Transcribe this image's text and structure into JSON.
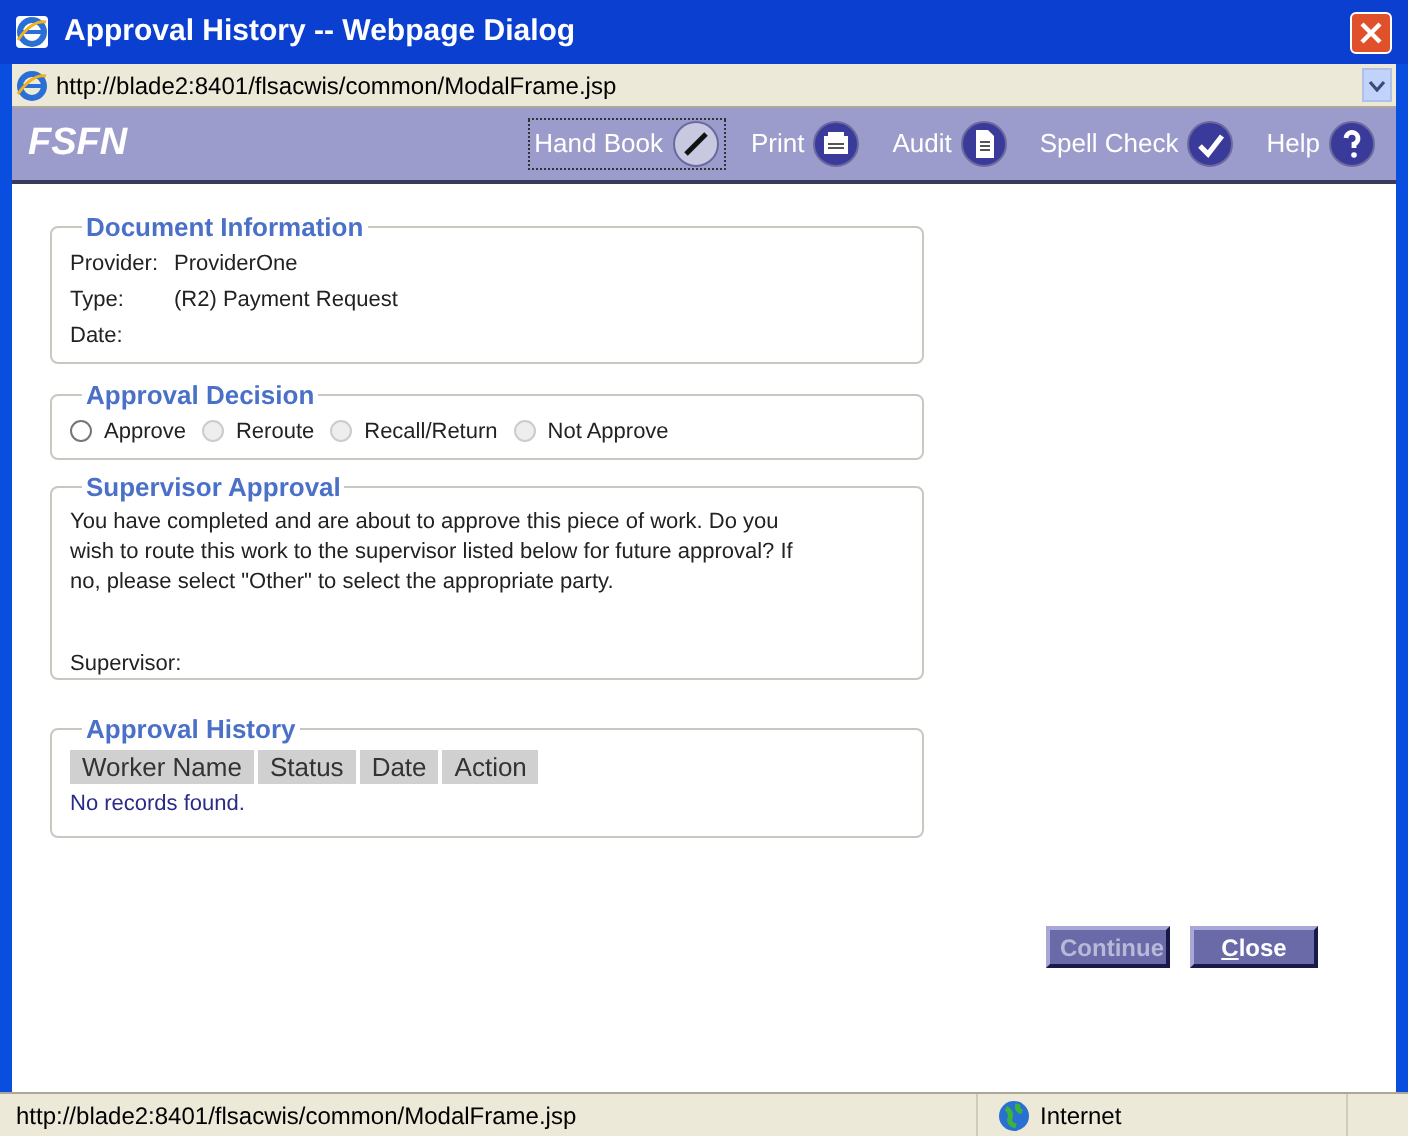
{
  "window": {
    "title": "Approval History -- Webpage Dialog"
  },
  "address": "http://blade2:8401/flsacwis/common/ModalFrame.jsp",
  "toolbar": {
    "brand": "FSFN",
    "items": [
      {
        "label": "Hand Book",
        "kind": "pen",
        "focused": true
      },
      {
        "label": "Print",
        "kind": "printer",
        "focused": false
      },
      {
        "label": "Audit",
        "kind": "document",
        "focused": false
      },
      {
        "label": "Spell Check",
        "kind": "spell",
        "focused": false
      },
      {
        "label": "Help",
        "kind": "help",
        "focused": false
      }
    ]
  },
  "document_information": {
    "legend": "Document Information",
    "fields": [
      {
        "label": "Provider:",
        "value": "ProviderOne"
      },
      {
        "label": "Type:",
        "value": "(R2) Payment Request"
      },
      {
        "label": "Date:"
      }
    ]
  },
  "approval_decision": {
    "legend": "Approval Decision",
    "options": [
      {
        "label": "Approve",
        "selected": false
      },
      {
        "label": "Reroute",
        "selected": false,
        "disabled": true
      },
      {
        "label": "Recall/Return",
        "selected": false,
        "disabled": true
      },
      {
        "label": "Not Approve",
        "selected": false,
        "disabled": true
      }
    ]
  },
  "supervisor_approval": {
    "legend": "Supervisor Approval",
    "message": "You have completed and are about to approve this piece of work. Do you wish to route this work to the supervisor listed below for future approval? If no, please select \"Other\" to select the appropriate party.",
    "supervisor_label": "Supervisor:"
  },
  "approval_history": {
    "legend": "Approval History",
    "columns": [
      "Worker Name",
      "Status",
      "Date",
      "Action"
    ],
    "empty_text": "No records found."
  },
  "buttons": [
    {
      "label": "Continue",
      "disabled": true
    },
    {
      "label": "Close",
      "disabled": false
    }
  ],
  "status_bar": {
    "url": "http://blade2:8401/flsacwis/common/ModalFrame.jsp",
    "zone": "Internet"
  }
}
